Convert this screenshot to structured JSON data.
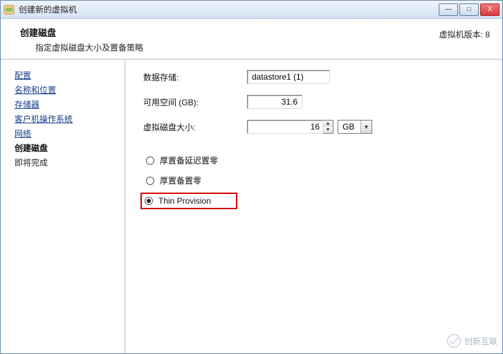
{
  "window": {
    "title": "创建新的虚拟机",
    "min": "—",
    "max": "□",
    "close": "X"
  },
  "header": {
    "title": "创建磁盘",
    "subtitle": "指定虚拟磁盘大小及置备策略",
    "version_label": "虚拟机版本: 8"
  },
  "sidebar": {
    "items": [
      {
        "label": "配置",
        "type": "link"
      },
      {
        "label": "名称和位置",
        "type": "link"
      },
      {
        "label": "存储器",
        "type": "link"
      },
      {
        "label": "客户机操作系统",
        "type": "link"
      },
      {
        "label": "网络",
        "type": "link"
      },
      {
        "label": "创建磁盘",
        "type": "bold"
      },
      {
        "label": "即将完成",
        "type": "plain"
      }
    ]
  },
  "form": {
    "datastore_label": "数据存储:",
    "datastore_value": "datastore1 (1)",
    "space_label": "可用空间 (GB):",
    "space_value": "31.6",
    "disksize_label": "虚拟磁盘大小:",
    "disksize_value": "16",
    "disksize_unit": "GB",
    "spin_up": "▲",
    "spin_down": "▼",
    "select_arrow": "▼",
    "radios": [
      {
        "label": "厚置备延迟置零",
        "selected": false
      },
      {
        "label": "厚置备置零",
        "selected": false
      },
      {
        "label": "Thin Provision",
        "selected": true,
        "highlighted": true
      }
    ]
  },
  "watermark": {
    "text": "创新互联"
  }
}
